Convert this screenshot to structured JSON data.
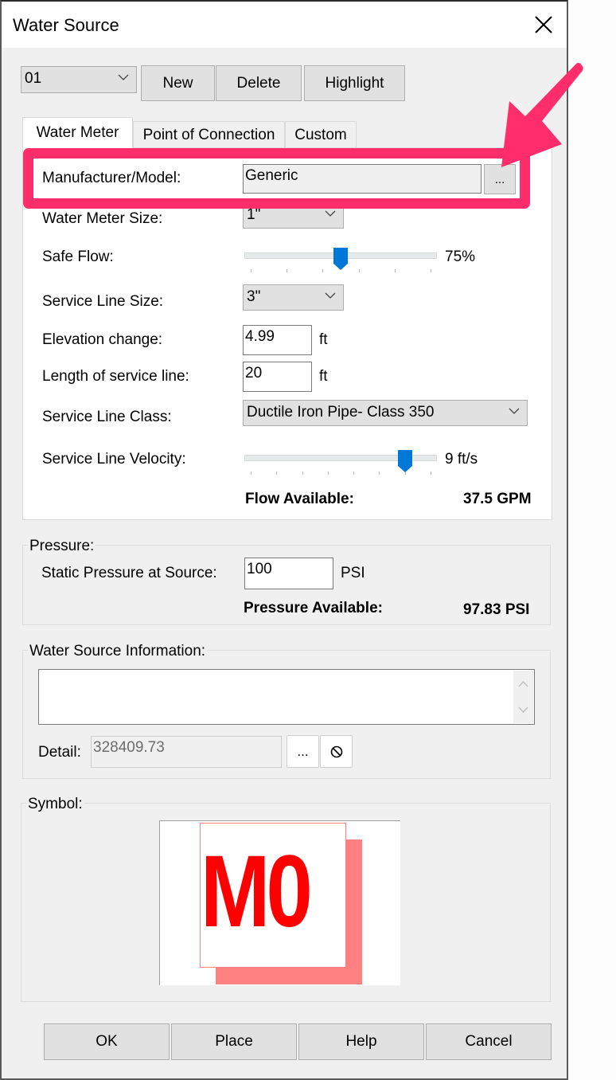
{
  "window": {
    "title": "Water Source",
    "close_icon": "close-icon"
  },
  "toolbar": {
    "source_select": {
      "value": "01"
    },
    "new_label": "New",
    "delete_label": "Delete",
    "highlight_label": "Highlight"
  },
  "tabs": [
    {
      "label": "Water Meter",
      "active": true
    },
    {
      "label": "Point of Connection",
      "active": false
    },
    {
      "label": "Custom",
      "active": false
    }
  ],
  "water_meter": {
    "manufacturer_label": "Manufacturer/Model:",
    "manufacturer_value": "Generic",
    "browse_label": "...",
    "meter_size_label": "Water Meter Size:",
    "meter_size_value": "1\"",
    "safe_flow_label": "Safe Flow:",
    "safe_flow_value": "75%",
    "safe_flow_position": 0.5,
    "safe_flow_ticks": 6,
    "service_line_size_label": "Service Line Size:",
    "service_line_size_value": "3\"",
    "elevation_label": "Elevation change:",
    "elevation_value": "4.99",
    "elevation_unit": "ft",
    "length_label": "Length of service line:",
    "length_value": "20",
    "length_unit": "ft",
    "class_label": "Service Line Class:",
    "class_value": "Ductile Iron Pipe- Class 350",
    "velocity_label": "Service Line Velocity:",
    "velocity_value": "9 ft/s",
    "velocity_position": 0.86,
    "velocity_ticks": 8,
    "flow_available_label": "Flow Available:",
    "flow_available_value": "37.5 GPM"
  },
  "pressure": {
    "group_title": "Pressure:",
    "static_label": "Static Pressure at Source:",
    "static_value": "100",
    "static_unit": "PSI",
    "available_label": "Pressure Available:",
    "available_value": "97.83 PSI"
  },
  "info": {
    "group_title": "Water Source Information:",
    "text_value": "",
    "detail_label": "Detail:",
    "detail_value": "328409.73",
    "browse_label": "...",
    "clear_icon": "no-symbol-icon"
  },
  "symbol": {
    "group_title": "Symbol:",
    "text": "M0",
    "color": "#ff0000",
    "shadow_color": "#ff8080"
  },
  "footer": {
    "ok_label": "OK",
    "place_label": "Place",
    "help_label": "Help",
    "cancel_label": "Cancel"
  },
  "annotation": {
    "color": "#ff2d6c"
  }
}
